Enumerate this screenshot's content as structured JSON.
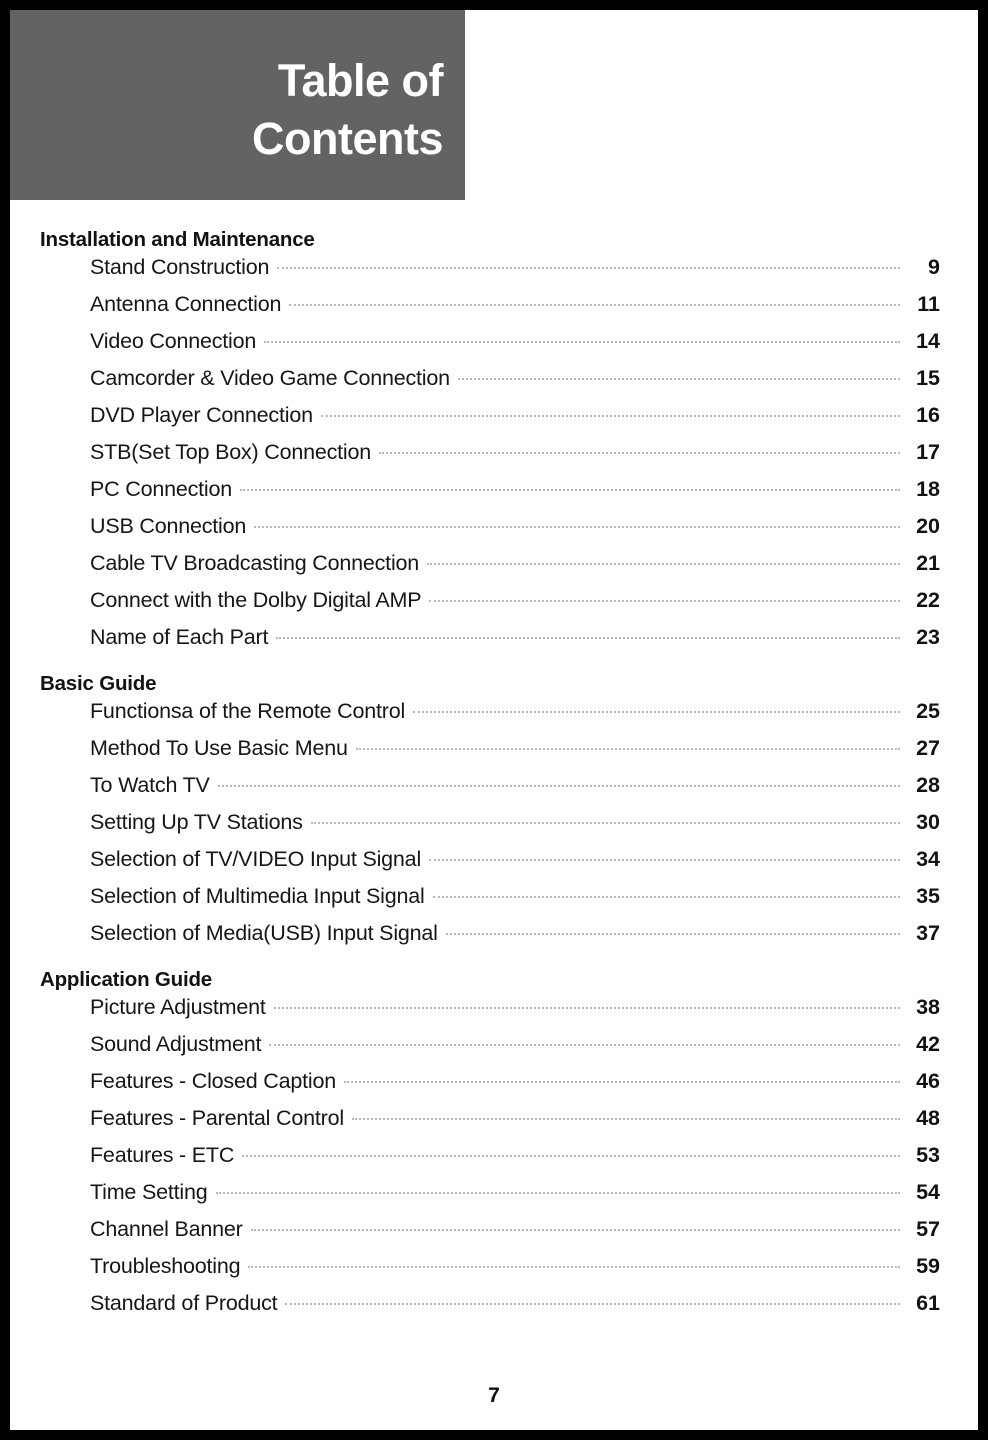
{
  "header": {
    "line1": "Table of",
    "line2": "Contents",
    "bg_color": "#636363",
    "text_color": "#ffffff"
  },
  "folio": "7",
  "sections": [
    {
      "heading": "Installation and Maintenance",
      "entries": [
        {
          "title": "Stand Construction",
          "page": "9"
        },
        {
          "title": "Antenna Connection",
          "page": "11"
        },
        {
          "title": "Video Connection",
          "page": "14"
        },
        {
          "title": "Camcorder & Video Game Connection",
          "page": "15"
        },
        {
          "title": "DVD Player Connection",
          "page": "16"
        },
        {
          "title": "STB(Set Top Box) Connection",
          "page": "17"
        },
        {
          "title": "PC Connection",
          "page": "18"
        },
        {
          "title": "USB Connection",
          "page": "20"
        },
        {
          "title": "Cable TV Broadcasting Connection",
          "page": "21"
        },
        {
          "title": "Connect with the Dolby Digital AMP",
          "page": "22"
        },
        {
          "title": "Name of Each Part",
          "page": "23"
        }
      ]
    },
    {
      "heading": "Basic Guide",
      "entries": [
        {
          "title": "Functionsa of the Remote Control",
          "page": "25"
        },
        {
          "title": "Method To Use Basic Menu",
          "page": "27"
        },
        {
          "title": "To Watch TV",
          "page": "28"
        },
        {
          "title": "Setting Up TV Stations",
          "page": "30"
        },
        {
          "title": "Selection of TV/VIDEO Input Signal",
          "page": "34"
        },
        {
          "title": "Selection of Multimedia Input Signal",
          "page": "35"
        },
        {
          "title": "Selection of Media(USB) Input Signal",
          "page": "37"
        }
      ]
    },
    {
      "heading": "Application Guide",
      "entries": [
        {
          "title": "Picture Adjustment",
          "page": "38"
        },
        {
          "title": "Sound Adjustment",
          "page": "42"
        },
        {
          "title": "Features - Closed Caption",
          "page": "46"
        },
        {
          "title": "Features - Parental Control",
          "page": "48"
        },
        {
          "title": "Features - ETC",
          "page": "53"
        },
        {
          "title": "Time Setting",
          "page": "54"
        },
        {
          "title": "Channel Banner",
          "page": "57"
        },
        {
          "title": "Troubleshooting",
          "page": "59"
        },
        {
          "title": "Standard of Product",
          "page": "61"
        }
      ]
    }
  ]
}
